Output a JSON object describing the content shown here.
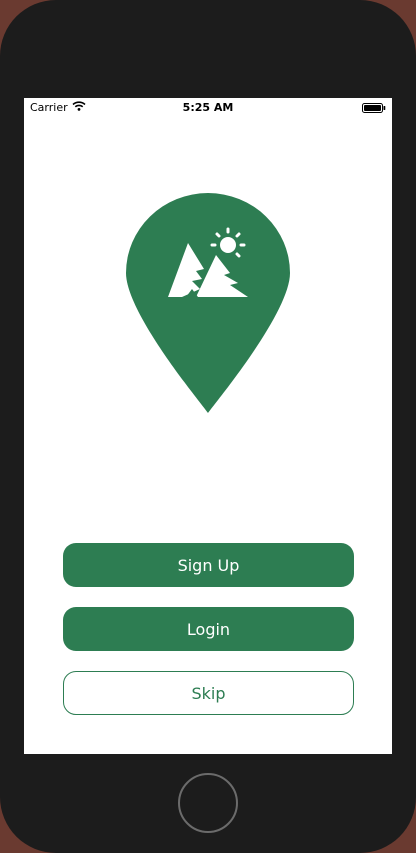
{
  "status_bar": {
    "carrier": "Carrier",
    "time": "5:25 AM"
  },
  "icons": {
    "wifi": "wifi-icon",
    "battery": "battery-icon",
    "logo": "map-pin-mountain-sun-icon"
  },
  "buttons": {
    "sign_up": "Sign Up",
    "login": "Login",
    "skip": "Skip"
  },
  "colors": {
    "brand": "#2d7d52",
    "screen_background": "#ffffff",
    "device_frame": "#1c1c1c"
  }
}
